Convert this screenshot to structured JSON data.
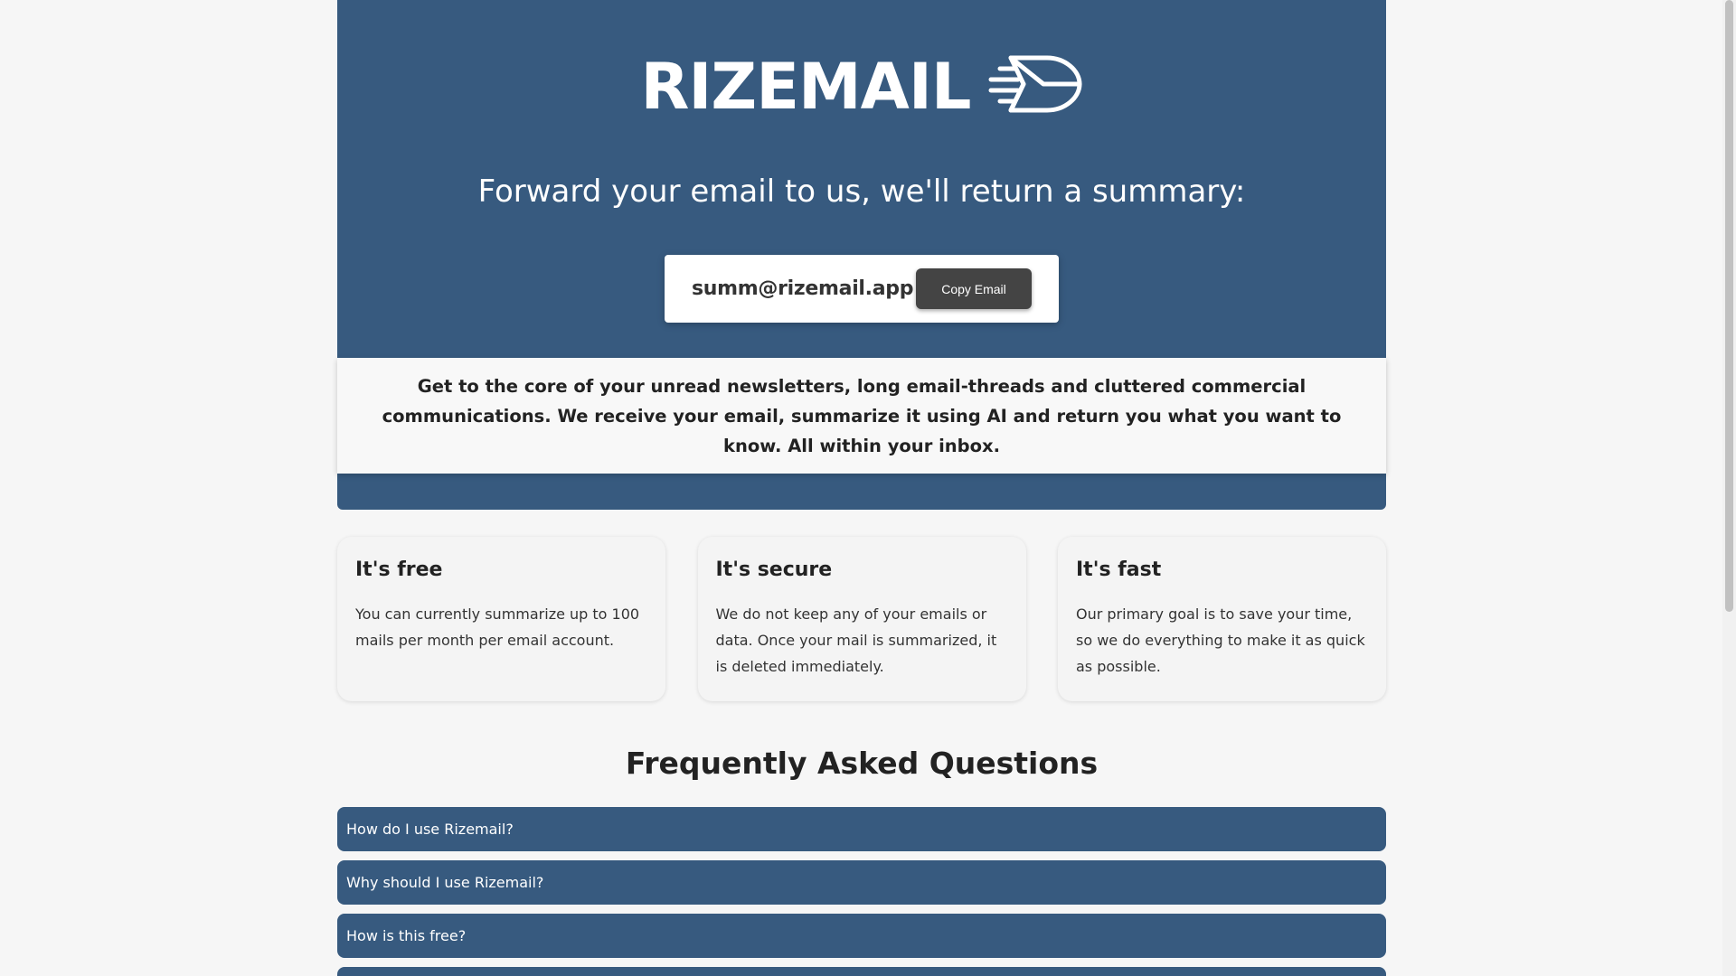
{
  "brand": {
    "logo_text": "RIZEMAIL",
    "logo_icon": "flying-envelope-icon"
  },
  "hero": {
    "tagline": "Forward your email to us, we'll return a summary:",
    "email": "summ@rizemail.app",
    "copy_button_label": "Copy Email",
    "background_color": "#375a7f"
  },
  "description": "Get to the core of your unread newsletters, long email-threads and cluttered commercial communications. We receive your email, summarize it using AI and return you what you want to know. All within your inbox.",
  "features": [
    {
      "title": "It's free",
      "text": "You can currently summarize up to 100 mails per month per email account."
    },
    {
      "title": "It's secure",
      "text": "We do not keep any of your emails or data. Once your mail is summarized, it is deleted immediately."
    },
    {
      "title": "It's fast",
      "text": "Our primary goal is to save your time, so we do everything to make it as quick as possible."
    }
  ],
  "faq": {
    "title": "Frequently Asked Questions",
    "items": [
      {
        "question": "How do I use Rizemail?"
      },
      {
        "question": "Why should I use Rizemail?"
      },
      {
        "question": "How is this free?"
      }
    ]
  }
}
